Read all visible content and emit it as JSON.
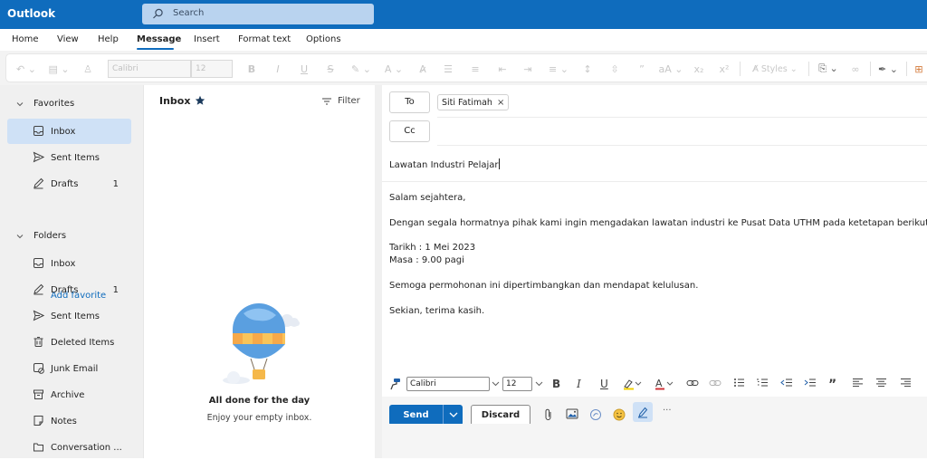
{
  "app": {
    "title": "Outlook"
  },
  "search": {
    "placeholder": "Search"
  },
  "tabs": [
    "Home",
    "View",
    "Help",
    "Message",
    "Insert",
    "Format text",
    "Options"
  ],
  "ribbon": {
    "font_name": "Calibri",
    "font_size": "12",
    "styles_label": "Styles"
  },
  "sidebar": {
    "favorites_label": "Favorites",
    "favorites": [
      {
        "label": "Inbox",
        "icon": "inbox-icon",
        "count": ""
      },
      {
        "label": "Sent Items",
        "icon": "send-icon",
        "count": ""
      },
      {
        "label": "Drafts",
        "icon": "pencil-icon",
        "count": "1"
      }
    ],
    "add_favorite": "Add favorite",
    "folders_label": "Folders",
    "folders": [
      {
        "label": "Inbox",
        "icon": "inbox-icon",
        "count": ""
      },
      {
        "label": "Drafts",
        "icon": "pencil-icon",
        "count": "1"
      },
      {
        "label": "Sent Items",
        "icon": "send-icon",
        "count": ""
      },
      {
        "label": "Deleted Items",
        "icon": "trash-icon",
        "count": ""
      },
      {
        "label": "Junk Email",
        "icon": "junk-icon",
        "count": ""
      },
      {
        "label": "Archive",
        "icon": "archive-icon",
        "count": ""
      },
      {
        "label": "Notes",
        "icon": "note-icon",
        "count": ""
      },
      {
        "label": "Conversation ...",
        "icon": "folder-icon",
        "count": ""
      }
    ]
  },
  "message_list": {
    "title": "Inbox",
    "filter_label": "Filter",
    "empty_title": "All done for the day",
    "empty_subtitle": "Enjoy your empty inbox."
  },
  "compose": {
    "to_label": "To",
    "cc_label": "Cc",
    "recipient": "Siti Fatimah",
    "subject": "Lawatan Industri Pelajar",
    "body": [
      "Salam sejahtera,",
      "Dengan segala hormatnya pihak kami ingin mengadakan lawatan industri ke Pusat Data UTHM pada ketetapan berikut;",
      "Tarikh : 1 Mei 2023",
      "Masa : 9.00 pagi",
      "Semoga permohonan ini dipertimbangkan dan mendapat kelulusan.",
      "Sekian, terima kasih."
    ],
    "font_name": "Calibri",
    "font_size": "12",
    "send_label": "Send",
    "discard_label": "Discard",
    "more_label": "···"
  },
  "colors": {
    "brand": "#0f6cbd",
    "selected": "#cfe1f6",
    "panel": "#f0f0f0"
  }
}
